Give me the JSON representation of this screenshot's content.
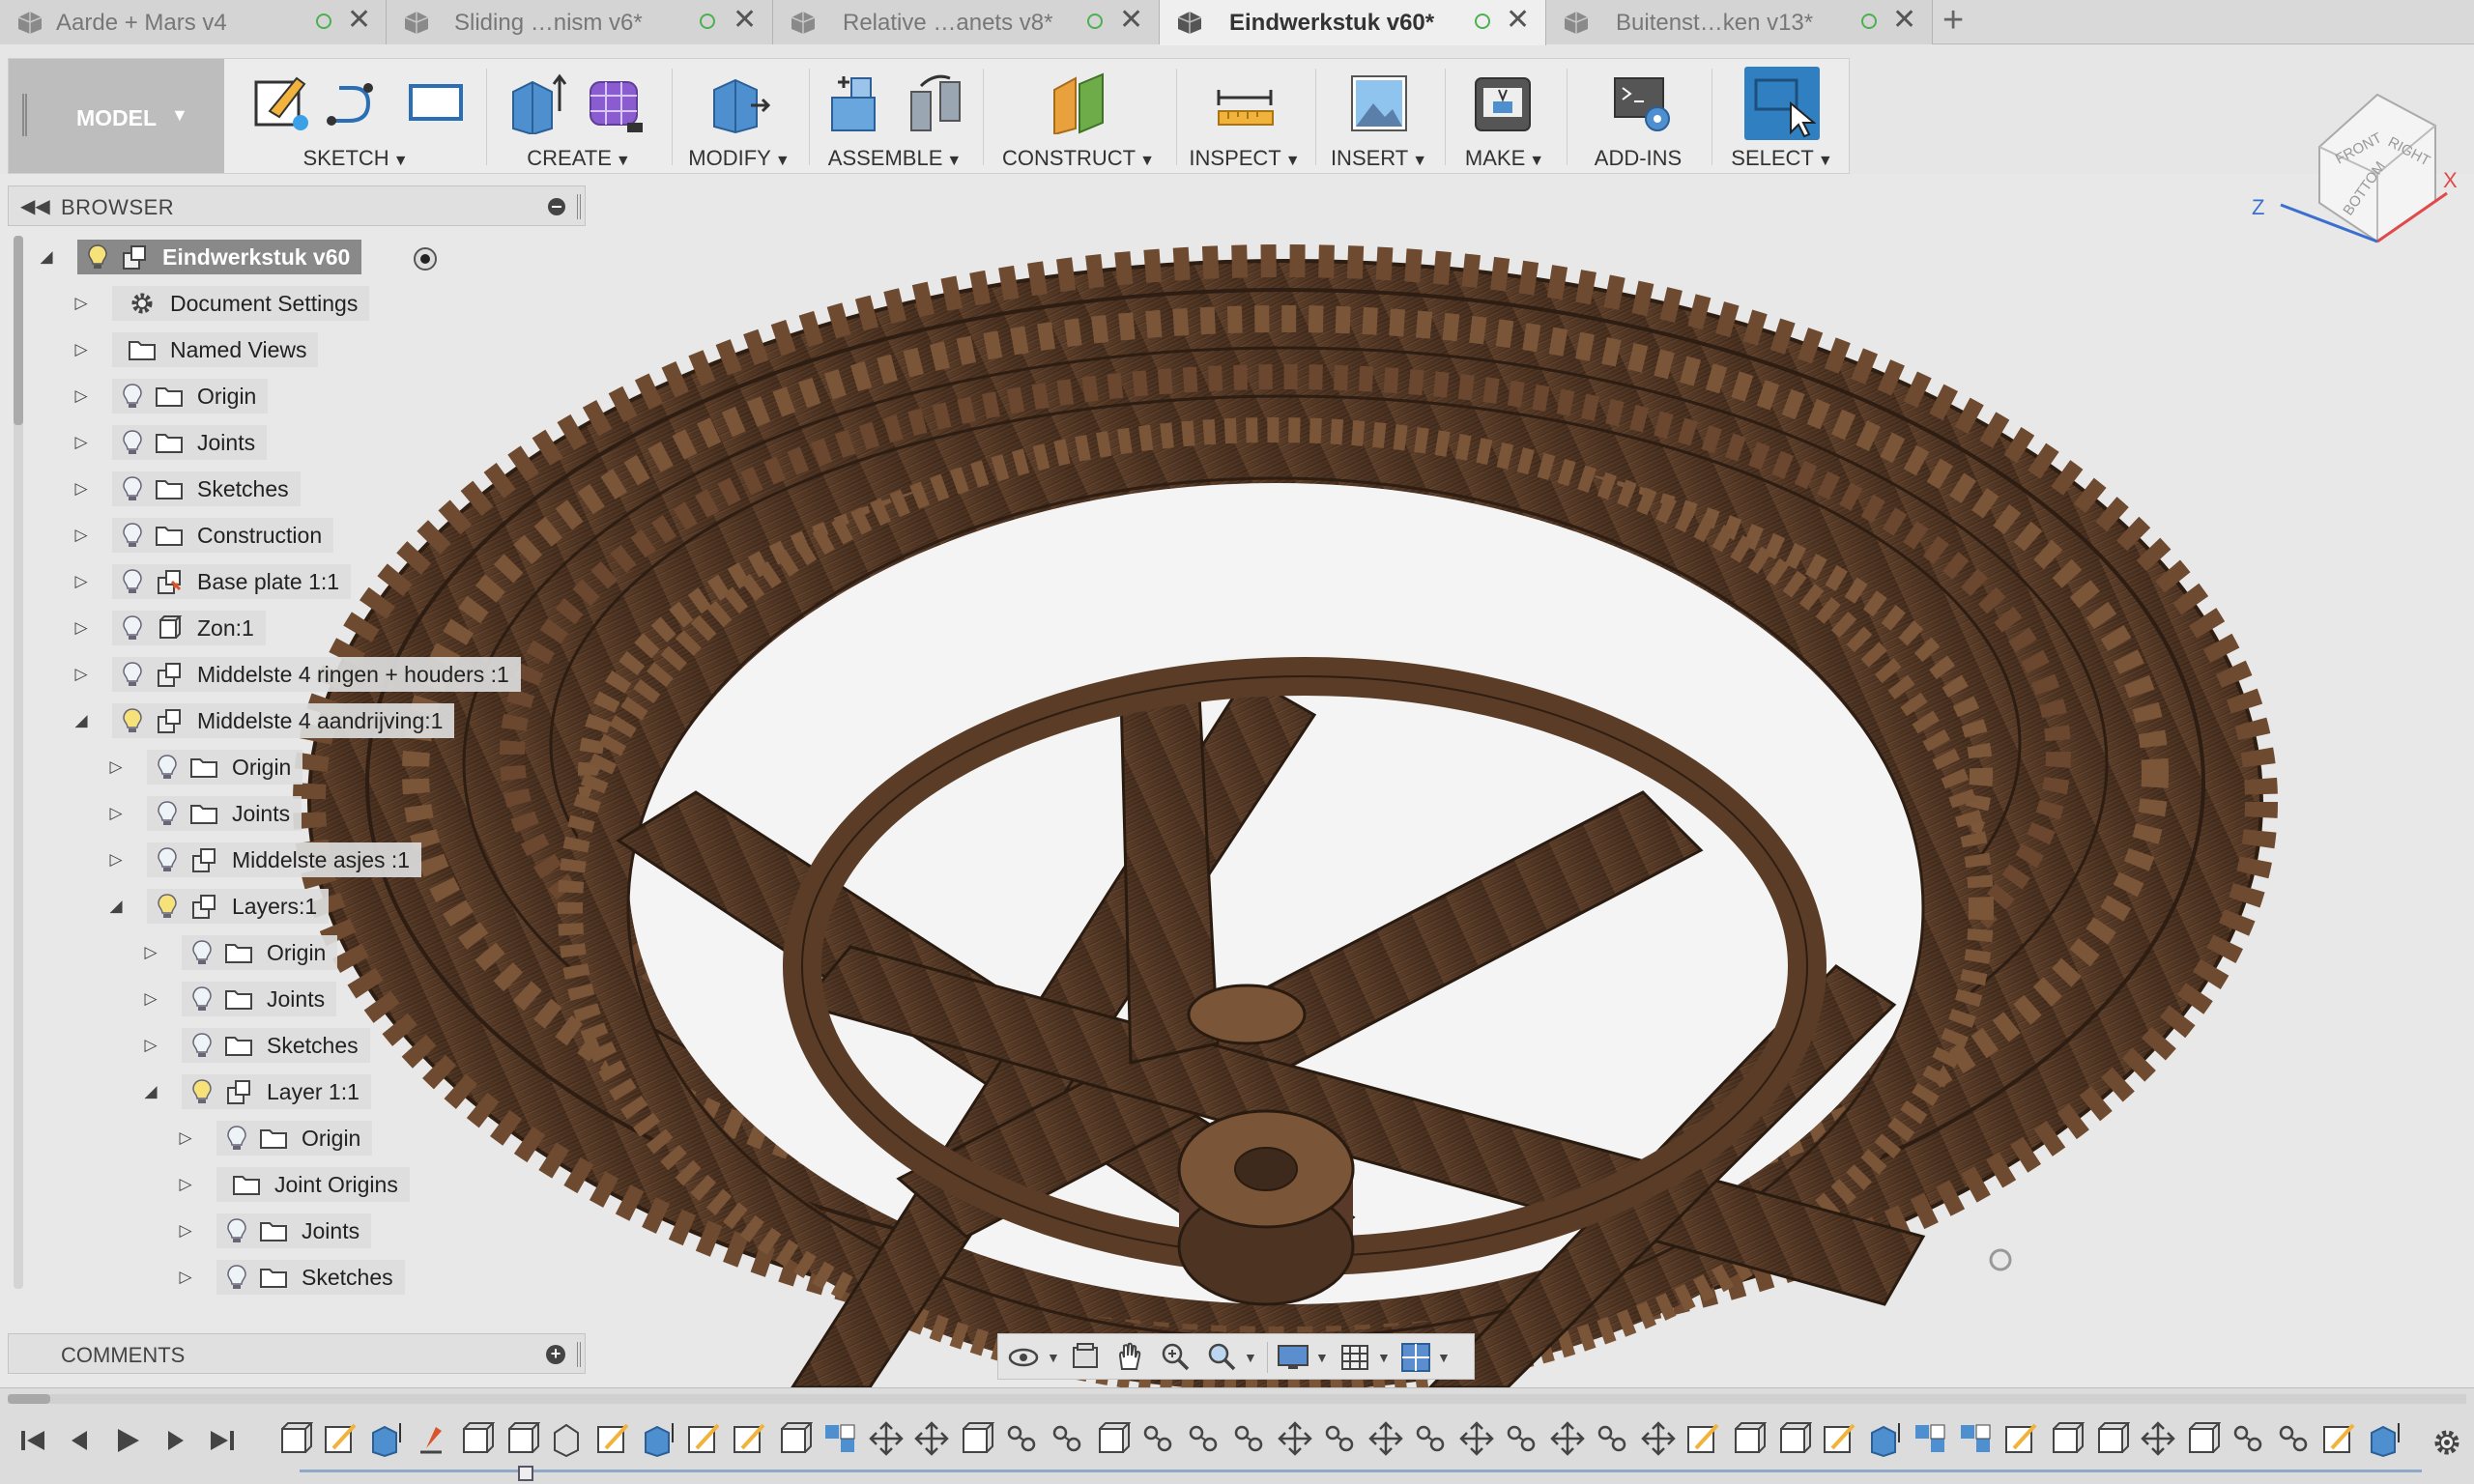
{
  "tabs": [
    {
      "label": "Aarde + Mars v4",
      "active": false
    },
    {
      "label": "Sliding …nism v6*",
      "active": false
    },
    {
      "label": "Relative …anets v8*",
      "active": false
    },
    {
      "label": "Eindwerkstuk v60*",
      "active": true
    },
    {
      "label": "Buitenst…ken v13*",
      "active": false
    }
  ],
  "new_tab_label": "+",
  "toolbar": {
    "mode": "MODEL",
    "groups": [
      {
        "label": "SKETCH"
      },
      {
        "label": "CREATE"
      },
      {
        "label": "MODIFY"
      },
      {
        "label": "ASSEMBLE"
      },
      {
        "label": "CONSTRUCT"
      },
      {
        "label": "INSPECT"
      },
      {
        "label": "INSERT"
      },
      {
        "label": "MAKE"
      },
      {
        "label": "ADD-INS"
      },
      {
        "label": "SELECT"
      }
    ]
  },
  "viewcube": {
    "front": "FRONT",
    "right": "RIGHT",
    "bottom": "BOTTOM",
    "axis_x": "X",
    "axis_z": "Z"
  },
  "browser": {
    "title": "BROWSER",
    "root": "Eindwerkstuk v60",
    "items": [
      {
        "label": "Document Settings",
        "level": 1,
        "expanded": false,
        "bulb": false,
        "icon": "gear-icon"
      },
      {
        "label": "Named Views",
        "level": 1,
        "expanded": false,
        "bulb": false,
        "icon": "folder-icon"
      },
      {
        "label": "Origin",
        "level": 1,
        "expanded": false,
        "bulb": true,
        "icon": "folder-icon"
      },
      {
        "label": "Joints",
        "level": 1,
        "expanded": false,
        "bulb": true,
        "icon": "folder-icon"
      },
      {
        "label": "Sketches",
        "level": 1,
        "expanded": false,
        "bulb": true,
        "icon": "folder-icon"
      },
      {
        "label": "Construction",
        "level": 1,
        "expanded": false,
        "bulb": true,
        "icon": "folder-icon"
      },
      {
        "label": "Base plate 1:1",
        "level": 1,
        "expanded": false,
        "bulb": true,
        "icon": "pinned-component-icon"
      },
      {
        "label": "Zon:1",
        "level": 1,
        "expanded": false,
        "bulb": true,
        "icon": "body-icon"
      },
      {
        "label": "Middelste 4 ringen + houders :1",
        "level": 1,
        "expanded": false,
        "bulb": true,
        "icon": "component-icon"
      },
      {
        "label": "Middelste 4 aandrijving:1",
        "level": 1,
        "expanded": true,
        "bulb": true,
        "icon": "component-icon"
      },
      {
        "label": "Origin",
        "level": 2,
        "expanded": false,
        "bulb": true,
        "icon": "folder-icon"
      },
      {
        "label": "Joints",
        "level": 2,
        "expanded": false,
        "bulb": true,
        "icon": "folder-icon"
      },
      {
        "label": "Middelste asjes :1",
        "level": 2,
        "expanded": false,
        "bulb": true,
        "icon": "component-icon"
      },
      {
        "label": "Layers:1",
        "level": 2,
        "expanded": true,
        "bulb": true,
        "icon": "component-icon"
      },
      {
        "label": "Origin",
        "level": 3,
        "expanded": false,
        "bulb": true,
        "icon": "folder-icon"
      },
      {
        "label": "Joints",
        "level": 3,
        "expanded": false,
        "bulb": true,
        "icon": "folder-icon"
      },
      {
        "label": "Sketches",
        "level": 3,
        "expanded": false,
        "bulb": true,
        "icon": "folder-icon"
      },
      {
        "label": "Layer 1:1",
        "level": 3,
        "expanded": true,
        "bulb": true,
        "icon": "component-icon"
      },
      {
        "label": "Origin",
        "level": 4,
        "expanded": false,
        "bulb": true,
        "icon": "folder-icon"
      },
      {
        "label": "Joint Origins",
        "level": 4,
        "expanded": false,
        "bulb": false,
        "icon": "folder-icon"
      },
      {
        "label": "Joints",
        "level": 4,
        "expanded": false,
        "bulb": true,
        "icon": "folder-icon"
      },
      {
        "label": "Sketches",
        "level": 4,
        "expanded": false,
        "bulb": true,
        "icon": "folder-icon"
      }
    ]
  },
  "comments": {
    "title": "COMMENTS"
  },
  "colors": {
    "wood_dark": "#3e2a1c",
    "wood_mid": "#5b3d27",
    "wood_light": "#7a5336",
    "select_blue": "#2f7fc1",
    "status_green": "#4caf50"
  }
}
